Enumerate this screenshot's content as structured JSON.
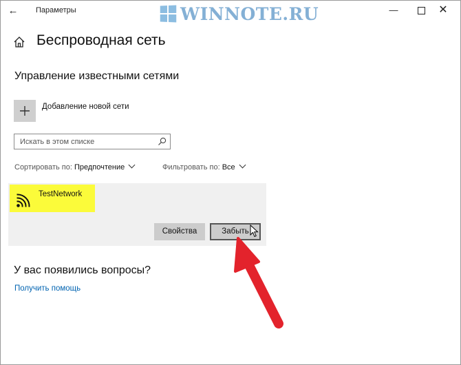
{
  "window": {
    "app_title": "Параметры",
    "watermark": "WINNOTE.RU"
  },
  "header": {
    "page_title": "Беспроводная сеть"
  },
  "manage": {
    "section_title": "Управление известными сетями",
    "add_network_label": "Добавление новой сети",
    "search_placeholder": "Искать в этом списке",
    "sort_label": "Сортировать по:",
    "sort_value": "Предпочтение",
    "filter_label": "Фильтровать по:",
    "filter_value": "Все"
  },
  "networks": [
    {
      "name": "TestNetwork",
      "icon": "wifi-icon",
      "properties_label": "Свойства",
      "forget_label": "Забыть"
    }
  ],
  "help": {
    "title": "У вас появились вопросы?",
    "link": "Получить помощь"
  },
  "colors": {
    "accent_link": "#0063b1",
    "highlight": "#fbfb3a",
    "annotation_arrow": "#e3232c",
    "card_bg": "#f0f0f0",
    "button_bg": "#cccccc"
  }
}
